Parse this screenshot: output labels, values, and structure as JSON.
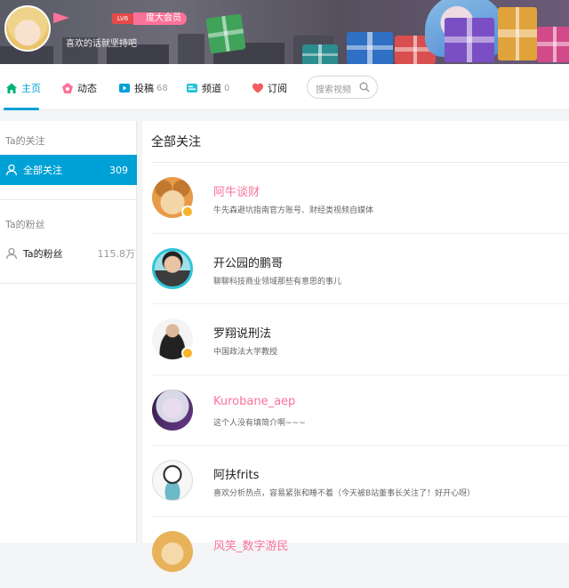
{
  "header": {
    "level_badge": "LV6",
    "vip_label": "度大会员",
    "sign": "喜欢的话就坚持吧"
  },
  "nav": {
    "home": "主页",
    "dynamic": "动态",
    "posts": "投稿",
    "posts_count": "68",
    "channel": "频道",
    "channel_count": "0",
    "subscribe": "订阅",
    "search_placeholder": "搜索视频"
  },
  "sidebar": {
    "following_heading": "Ta的关注",
    "all_following_label": "全部关注",
    "all_following_count": "309",
    "fans_heading": "Ta的粉丝",
    "fans_label": "Ta的粉丝",
    "fans_count": "115.8万"
  },
  "main": {
    "title": "全部关注",
    "users": [
      {
        "name": "阿牛谈财",
        "desc": "牛先森避坑指南官方账号、财经类视频自媒体",
        "vip": true,
        "verified": true
      },
      {
        "name": "开公园的鹏哥",
        "desc": "聊聊科技商业领域那些有意思的事儿",
        "vip": false,
        "verified": false
      },
      {
        "name": "罗翔说刑法",
        "desc": "中国政法大学教授",
        "vip": false,
        "verified": true
      },
      {
        "name": "Kurobane_aep",
        "desc": "这个人没有填简介啊~~~",
        "vip": true,
        "verified": false
      },
      {
        "name": "阿扶frits",
        "desc": "喜欢分析热点，容易紧张和睡不着（今天被B站董事长关注了！好开心呀）",
        "vip": false,
        "verified": false
      },
      {
        "name": "风笑_数字游民",
        "desc": "",
        "vip": true,
        "verified": false
      }
    ]
  },
  "colors": {
    "accent": "#00a1d6",
    "vip_pink": "#fb7299"
  }
}
